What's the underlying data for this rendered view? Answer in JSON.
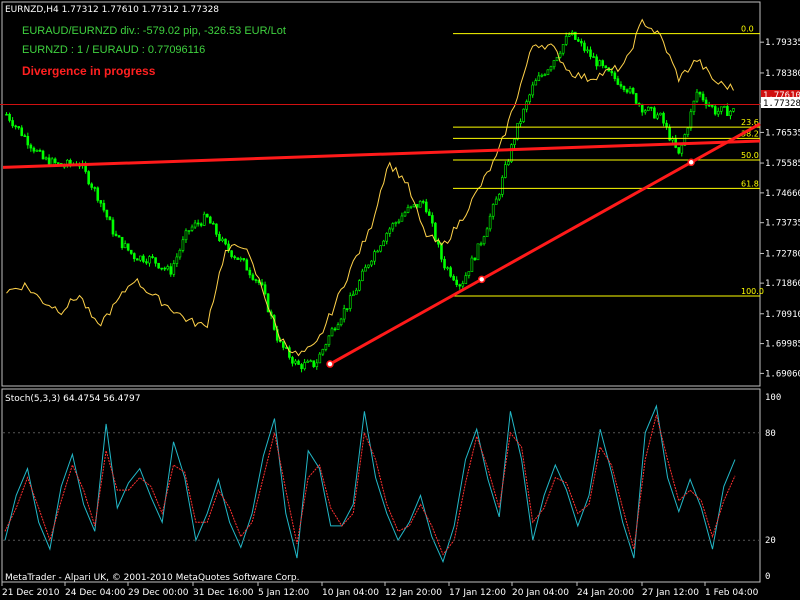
{
  "header": {
    "symbol_line": "EURNZD,H4  1.77312 1.77610 1.77312 1.77328",
    "info_line1": "EURAUD/EURNZD div.: -579.02 pip, -326.53 EUR/Lot",
    "info_line2": "EURNZD : 1 / EURAUD : 0.77096116",
    "alert": "Divergence in progress"
  },
  "indicator": {
    "label": "Stoch(5,3,3) 64.4754 56.4797"
  },
  "footer": {
    "copyright": "MetaTrader - Alpari UK, © 2001-2010 MetaQuotes Software Corp."
  },
  "colors": {
    "background": "#000000",
    "bull": "#00ff00",
    "bear": "#00ff00",
    "overlay": "#ffd24a",
    "trend": "#ff1a1a",
    "fib": "#ffff00",
    "stoch_main": "#22b8c8",
    "stoch_signal": "#ff3030",
    "grid_text": "#ffffff"
  },
  "chart_data": [
    {
      "type": "candlestick",
      "title": "EURNZD,H4",
      "ylim": [
        1.687,
        1.8055
      ],
      "yticks": [
        "1.79335",
        "1.78380",
        "1.77425",
        "1.76535",
        "1.75585",
        "1.74660",
        "1.73735",
        "1.72780",
        "1.71860",
        "1.70910",
        "1.69985",
        "1.69060"
      ],
      "xticks": [
        "21 Dec 2010",
        "24 Dec 04:00",
        "29 Dec 00:00",
        "31 Dec 16:00",
        "5 Jan 12:00",
        "10 Jan 04:00",
        "12 Jan 20:00",
        "17 Jan 12:00",
        "20 Jan 04:00",
        "24 Jan 20:00",
        "27 Jan 12:00",
        "1 Feb 04:00"
      ],
      "current_price": "1.77328",
      "red_price": "1.77610",
      "anchors": [
        1.771,
        1.764,
        1.757,
        1.755,
        1.756,
        1.746,
        1.733,
        1.727,
        1.726,
        1.722,
        1.735,
        1.739,
        1.73,
        1.725,
        1.718,
        1.7,
        1.693,
        1.6935,
        1.705,
        1.714,
        1.726,
        1.735,
        1.741,
        1.744,
        1.725,
        1.718,
        1.73,
        1.745,
        1.765,
        1.78,
        1.787,
        1.796,
        1.79,
        1.784,
        1.78,
        1.773,
        1.77,
        1.758,
        1.778,
        1.772,
        1.772
      ],
      "overlay_anchors": [
        1.716,
        1.718,
        1.713,
        1.71,
        1.715,
        1.705,
        1.712,
        1.72,
        1.715,
        1.711,
        1.707,
        1.705,
        1.728,
        1.731,
        1.718,
        1.702,
        1.696,
        1.699,
        1.711,
        1.724,
        1.735,
        1.756,
        1.75,
        1.734,
        1.73,
        1.738,
        1.748,
        1.758,
        1.775,
        1.793,
        1.792,
        1.784,
        1.782,
        1.784,
        1.786,
        1.8,
        1.795,
        1.782,
        1.788,
        1.781,
        1.779
      ],
      "fibonacci": {
        "levels": [
          "0.0",
          "23.6",
          "38.2",
          "50.0",
          "61.8",
          "100.0"
        ],
        "prices": [
          1.796,
          1.767,
          1.7635,
          1.7568,
          1.748,
          1.7146
        ]
      },
      "horizontal_line": 1.774,
      "support_trendline": [
        [
          1.6935,
          "10 Jan 04:00"
        ],
        [
          1.768,
          "1 Feb 04:00"
        ]
      ],
      "resistance_trendline": [
        1.7545,
        1.7627
      ]
    },
    {
      "type": "line",
      "title": "Stoch(5,3,3)",
      "ylim": [
        0,
        100
      ],
      "yticks": [
        "100",
        "80",
        "20",
        "0"
      ],
      "series": [
        {
          "values": [
            20,
            45,
            60,
            30,
            15,
            50,
            68,
            40,
            25,
            85,
            38,
            52,
            60,
            44,
            30,
            75,
            55,
            20,
            35,
            54,
            30,
            16,
            35,
            67,
            88,
            35,
            10,
            70,
            60,
            28,
            28,
            40,
            92,
            55,
            35,
            20,
            30,
            45,
            22,
            8,
            28,
            65,
            82,
            54,
            33,
            92,
            65,
            20,
            45,
            62,
            48,
            28,
            45,
            82,
            58,
            30,
            10,
            80,
            95,
            55,
            36,
            54,
            38,
            15,
            50,
            65
          ]
        },
        {
          "values": [
            25,
            38,
            55,
            38,
            20,
            42,
            62,
            48,
            28,
            70,
            48,
            48,
            55,
            50,
            35,
            62,
            58,
            30,
            30,
            48,
            38,
            22,
            30,
            55,
            80,
            48,
            18,
            55,
            62,
            38,
            28,
            35,
            80,
            65,
            40,
            25,
            28,
            40,
            28,
            12,
            20,
            52,
            78,
            60,
            38,
            80,
            72,
            30,
            38,
            55,
            52,
            35,
            40,
            72,
            62,
            38,
            15,
            65,
            90,
            65,
            42,
            48,
            42,
            22,
            42,
            56
          ]
        }
      ]
    }
  ]
}
